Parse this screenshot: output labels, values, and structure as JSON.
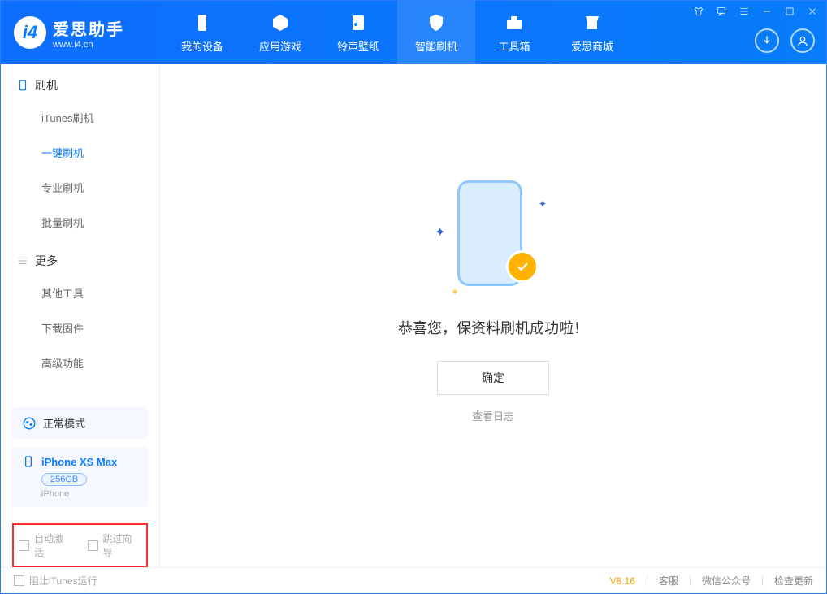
{
  "app": {
    "title": "爱思助手",
    "subtitle": "www.i4.cn"
  },
  "nav": {
    "tabs": [
      {
        "label": "我的设备"
      },
      {
        "label": "应用游戏"
      },
      {
        "label": "铃声壁纸"
      },
      {
        "label": "智能刷机"
      },
      {
        "label": "工具箱"
      },
      {
        "label": "爱思商城"
      }
    ]
  },
  "sidebar": {
    "section1": {
      "title": "刷机"
    },
    "items1": [
      {
        "label": "iTunes刷机"
      },
      {
        "label": "一键刷机"
      },
      {
        "label": "专业刷机"
      },
      {
        "label": "批量刷机"
      }
    ],
    "section2": {
      "title": "更多"
    },
    "items2": [
      {
        "label": "其他工具"
      },
      {
        "label": "下载固件"
      },
      {
        "label": "高级功能"
      }
    ],
    "mode": "正常模式",
    "device": {
      "name": "iPhone XS Max",
      "storage": "256GB",
      "type": "iPhone"
    },
    "opt1": "自动激活",
    "opt2": "跳过向导"
  },
  "main": {
    "success_msg": "恭喜您，保资料刷机成功啦！",
    "ok": "确定",
    "view_log": "查看日志"
  },
  "footer": {
    "block_itunes": "阻止iTunes运行",
    "version": "V8.16",
    "links": [
      "客服",
      "微信公众号",
      "检查更新"
    ]
  }
}
